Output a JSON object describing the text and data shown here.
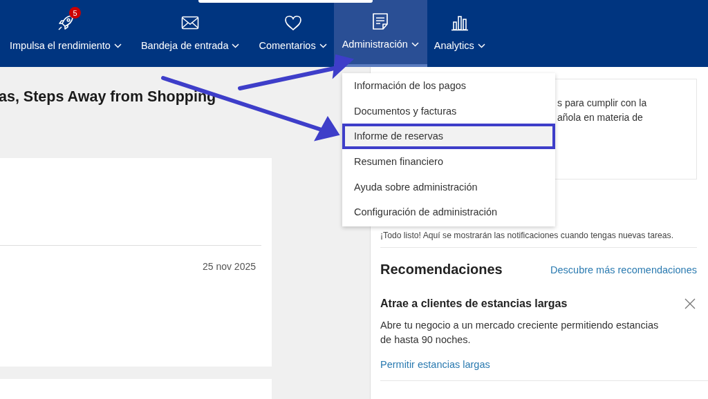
{
  "nav": {
    "items": [
      {
        "label": "Impulsa el rendimiento",
        "kind": "rocket",
        "badge": "5",
        "selected": false
      },
      {
        "label": "Bandeja de entrada",
        "kind": "mail",
        "selected": false
      },
      {
        "label": "Comentarios",
        "kind": "heart",
        "selected": false
      },
      {
        "label": "Administración",
        "kind": "note",
        "selected": true
      },
      {
        "label": "Analytics",
        "kind": "chart",
        "selected": false
      }
    ]
  },
  "menu": {
    "items": [
      {
        "label": "Información de los pagos",
        "selected": false
      },
      {
        "label": "Documentos y facturas",
        "selected": false
      },
      {
        "label": "Informe de reservas",
        "selected": true
      },
      {
        "label": "Resumen financiero",
        "selected": false
      },
      {
        "label": "Ayuda sobre administración",
        "selected": false
      },
      {
        "label": "Configuración de administración",
        "selected": false
      }
    ]
  },
  "main": {
    "title": "as, Steps Away from Shopping",
    "card": {
      "date": "25 nov 2025"
    }
  },
  "side": {
    "notice_lines": [
      "s para cumplir con la",
      "añola en materia de"
    ],
    "notifications": "¡Todo listo! Aquí se mostrarán las notificaciones cuando tengas nuevas tareas.",
    "recommendations": {
      "title": "Recomendaciones",
      "link": "Descubre más recomendaciones",
      "item": {
        "title": "Atrae a clientes de estancias largas",
        "text": "Abre tu negocio a un mercado creciente permitiendo estancias de hasta 90 noches.",
        "action": "Permitir estancias largas"
      }
    }
  }
}
